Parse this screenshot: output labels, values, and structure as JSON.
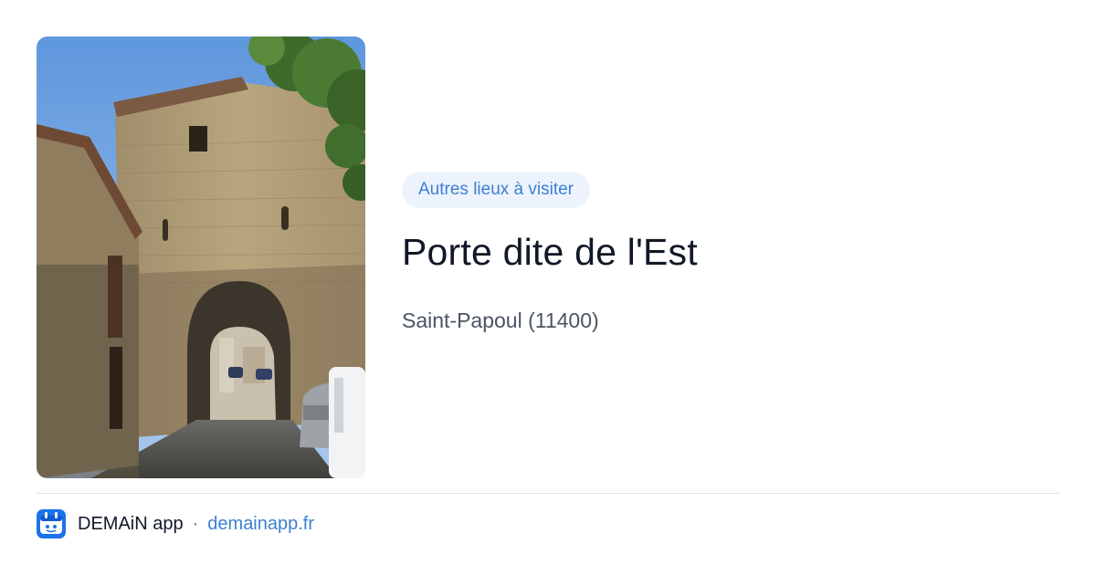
{
  "card": {
    "badge": "Autres lieux à visiter",
    "title": "Porte dite de l'Est",
    "location": "Saint-Papoul (11400)"
  },
  "footer": {
    "brand": "DEMAiN app",
    "separator": "·",
    "url": "demainapp.fr"
  },
  "photo": {
    "subject": "photo of a medieval stone gate tower with an arched passage"
  },
  "colors": {
    "accent": "#3b7fd0",
    "badge_bg": "#edf3fc",
    "title": "#111827",
    "subtitle": "#4b5563",
    "divider": "#dde3ea"
  }
}
